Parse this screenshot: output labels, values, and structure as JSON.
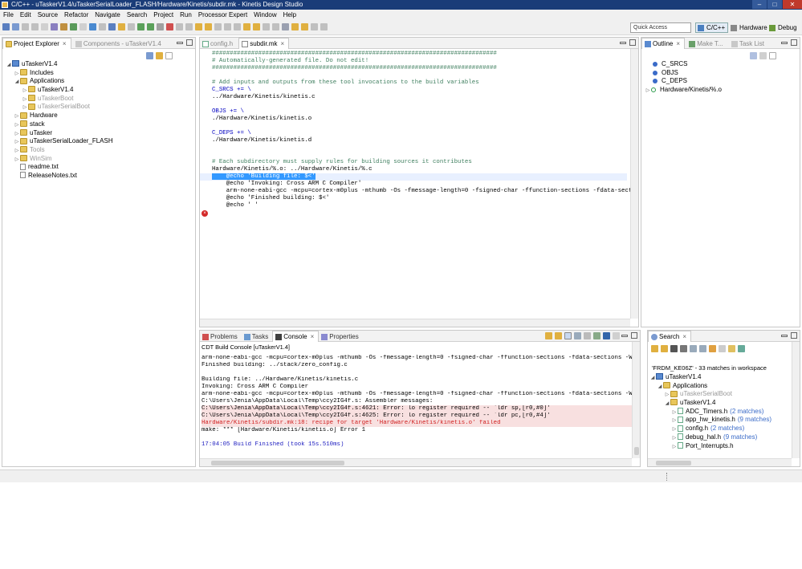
{
  "window": {
    "title": "C/C++ - uTaskerV1.4/uTaskerSerialLoader_FLASH/Hardware/Kinetis/subdir.mk - Kinetis Design Studio"
  },
  "menu": [
    "File",
    "Edit",
    "Source",
    "Refactor",
    "Navigate",
    "Search",
    "Project",
    "Run",
    "Processor Expert",
    "Window",
    "Help"
  ],
  "toolbar": {
    "quick_access": "Quick Access",
    "perspectives": [
      {
        "label": "C/C++",
        "active": true
      },
      {
        "label": "Hardware",
        "active": false
      },
      {
        "label": "Debug",
        "active": false
      }
    ]
  },
  "project_explorer": {
    "tabs": [
      {
        "label": "Project Explorer",
        "active": true
      },
      {
        "label": "Components - uTaskerV1.4",
        "active": false
      }
    ],
    "tree": [
      {
        "level": 0,
        "label": "uTaskerV1.4",
        "icon": "project",
        "twisty": "open"
      },
      {
        "level": 1,
        "label": "Includes",
        "icon": "folder",
        "twisty": "closed"
      },
      {
        "level": 1,
        "label": "Applications",
        "icon": "folder",
        "twisty": "open"
      },
      {
        "level": 2,
        "label": "uTaskerV1.4",
        "icon": "folder",
        "twisty": "closed"
      },
      {
        "level": 2,
        "label": "uTaskerBoot",
        "icon": "folder",
        "twisty": "closed",
        "grey": true
      },
      {
        "level": 2,
        "label": "uTaskerSerialBoot",
        "icon": "folder",
        "twisty": "closed",
        "grey": true
      },
      {
        "level": 1,
        "label": "Hardware",
        "icon": "folder",
        "twisty": "closed"
      },
      {
        "level": 1,
        "label": "stack",
        "icon": "folder",
        "twisty": "closed"
      },
      {
        "level": 1,
        "label": "uTasker",
        "icon": "folder",
        "twisty": "closed"
      },
      {
        "level": 1,
        "label": "uTaskerSerialLoader_FLASH",
        "icon": "folder",
        "twisty": "closed"
      },
      {
        "level": 1,
        "label": "Tools",
        "icon": "folder",
        "twisty": "closed",
        "grey": true
      },
      {
        "level": 1,
        "label": "WinSim",
        "icon": "folder",
        "twisty": "closed",
        "grey": true
      },
      {
        "level": 1,
        "label": "readme.txt",
        "icon": "file",
        "twisty": "none"
      },
      {
        "level": 1,
        "label": "ReleaseNotes.txt",
        "icon": "file",
        "twisty": "none"
      }
    ]
  },
  "editor": {
    "tabs": [
      {
        "label": "config.h",
        "active": false
      },
      {
        "label": "subdir.mk",
        "active": true
      }
    ],
    "lines": [
      {
        "text": "################################################################################",
        "style": "comment"
      },
      {
        "text": "# Automatically-generated file. Do not edit!",
        "style": "comment"
      },
      {
        "text": "################################################################################",
        "style": "comment"
      },
      {
        "text": "",
        "style": "plain"
      },
      {
        "text": "# Add inputs and outputs from these tool invocations to the build variables",
        "style": "comment"
      },
      {
        "text": "C_SRCS += \\",
        "style": "var"
      },
      {
        "text": "../Hardware/Kinetis/kinetis.c",
        "style": "plain"
      },
      {
        "text": "",
        "style": "plain"
      },
      {
        "text": "OBJS += \\",
        "style": "var"
      },
      {
        "text": "./Hardware/Kinetis/kinetis.o",
        "style": "plain"
      },
      {
        "text": "",
        "style": "plain"
      },
      {
        "text": "C_DEPS += \\",
        "style": "var"
      },
      {
        "text": "./Hardware/Kinetis/kinetis.d",
        "style": "plain"
      },
      {
        "text": "",
        "style": "plain"
      },
      {
        "text": "",
        "style": "plain"
      },
      {
        "text": "# Each subdirectory must supply rules for building sources it contributes",
        "style": "comment"
      },
      {
        "text": "Hardware/Kinetis/%.o: ../Hardware/Kinetis/%.c",
        "style": "plain"
      },
      {
        "text": "    @echo 'Building file: $<'",
        "style": "selected"
      },
      {
        "text": "    @echo 'Invoking: Cross ARM C Compiler'",
        "style": "plain"
      },
      {
        "text": "    arm-none-eabi-gcc -mcpu=cortex-m0plus -mthumb -Os -fmessage-length=0 -fsigned-char -ffunction-sections -fdata-sections",
        "style": "plain"
      },
      {
        "text": "    @echo 'Finished building: $<'",
        "style": "plain"
      },
      {
        "text": "    @echo ' '",
        "style": "plain"
      }
    ]
  },
  "outline": {
    "tabs": [
      {
        "label": "Outline",
        "active": true
      },
      {
        "label": "Make T...",
        "active": false
      },
      {
        "label": "Task List",
        "active": false
      }
    ],
    "items": [
      {
        "label": "C_SRCS",
        "icon": "circle"
      },
      {
        "label": "OBJS",
        "icon": "circle"
      },
      {
        "label": "C_DEPS",
        "icon": "circle"
      },
      {
        "label": "Hardware/Kinetis/%.o",
        "icon": "target"
      }
    ]
  },
  "console": {
    "tabs": [
      {
        "label": "Problems",
        "active": false
      },
      {
        "label": "Tasks",
        "active": false
      },
      {
        "label": "Console",
        "active": true
      },
      {
        "label": "Properties",
        "active": false
      }
    ],
    "header": "CDT Build Console [uTaskerV1.4]",
    "lines": [
      {
        "text": "arm-none-eabi-gcc -mcpu=cortex-m0plus -mthumb -Os -fmessage-length=0 -fsigned-char -ffunction-sections -fdata-sections -Wall  -g",
        "style": "plain"
      },
      {
        "text": "Finished building: ../stack/zero_config.c",
        "style": "plain"
      },
      {
        "text": "",
        "style": "plain"
      },
      {
        "text": "Building file: ../Hardware/Kinetis/kinetis.c",
        "style": "plain"
      },
      {
        "text": "Invoking: Cross ARM C Compiler",
        "style": "plain"
      },
      {
        "text": "arm-none-eabi-gcc -mcpu=cortex-m0plus -mthumb -Os -fmessage-length=0 -fsigned-char -ffunction-sections -fdata-sections -Wall  -g",
        "style": "plain"
      },
      {
        "text": "C:\\Users\\Jenia\\AppData\\Local\\Temp\\ccy2IG4f.s: Assembler messages:",
        "style": "plain"
      },
      {
        "text": "C:\\Users\\Jenia\\AppData\\Local\\Temp\\ccy2IG4f.s:4621: Error: lo register required -- `ldr sp,[r0,#0]'",
        "style": "err"
      },
      {
        "text": "C:\\Users\\Jenia\\AppData\\Local\\Temp\\ccy2IG4f.s:4625: Error: lo register required -- `ldr pc,[r0,#4]'",
        "style": "err"
      },
      {
        "text": "Hardware/Kinetis/subdir.mk:18: recipe for target 'Hardware/Kinetis/kinetis.o' failed",
        "style": "red"
      },
      {
        "text": "make: *** [Hardware/Kinetis/kinetis.o] Error 1",
        "style": "plain"
      },
      {
        "text": "",
        "style": "plain"
      },
      {
        "text": "17:04:05 Build Finished (took 15s.510ms)",
        "style": "blue"
      }
    ]
  },
  "search": {
    "tab": "Search",
    "summary": "'FRDM_KE06Z' - 33 matches in workspace",
    "tree": [
      {
        "level": 0,
        "label": "uTaskerV1.4",
        "icon": "project",
        "twisty": "open"
      },
      {
        "level": 1,
        "label": "Applications",
        "icon": "folder",
        "twisty": "open"
      },
      {
        "level": 2,
        "label": "uTaskerSerialBoot",
        "icon": "folder",
        "twisty": "closed",
        "grey": true
      },
      {
        "level": 2,
        "label": "uTaskerV1.4",
        "icon": "folder",
        "twisty": "open"
      },
      {
        "level": 3,
        "label": "ADC_Timers.h",
        "icon": "fileh",
        "twisty": "closed",
        "matches": "(2 matches)"
      },
      {
        "level": 3,
        "label": "app_hw_kinetis.h",
        "icon": "fileh",
        "twisty": "closed",
        "matches": "(9 matches)"
      },
      {
        "level": 3,
        "label": "config.h",
        "icon": "fileh",
        "twisty": "closed",
        "matches": "(2 matches)"
      },
      {
        "level": 3,
        "label": "debug_hal.h",
        "icon": "fileh",
        "twisty": "closed",
        "matches": "(9 matches)"
      },
      {
        "level": 3,
        "label": "Port_Interrupts.h",
        "icon": "fileh",
        "twisty": "closed",
        "matches": ""
      }
    ]
  },
  "colors": {
    "titlebar": "#1a3c78",
    "comment": "#3f7f5f",
    "variable": "#0000c0",
    "selection": "#3399ff",
    "error_text": "#d02020",
    "error_bg": "#f8e0e0"
  }
}
